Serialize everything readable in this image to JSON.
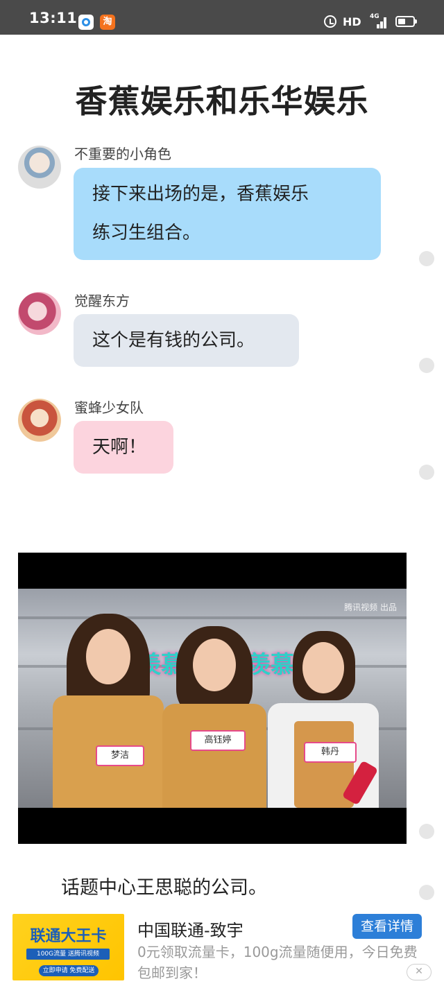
{
  "status_bar": {
    "time": "13:11",
    "app_icon_b_label": "淘",
    "network_label": "HD",
    "signal_label": "4G"
  },
  "article": {
    "title": "香蕉娱乐和乐华娱乐",
    "messages": [
      {
        "sender": "不重要的小角色",
        "text_lines": [
          "接下来出场的是，香蕉娱乐",
          "练习生组合。"
        ],
        "bubble_color": "#a8dcfb"
      },
      {
        "sender": "觉醒东方",
        "text_lines": [
          "这个是有钱的公司。"
        ],
        "bubble_color": "#e3e8ef"
      },
      {
        "sender": "蜜蜂少女队",
        "text_lines": [
          "天啊！"
        ],
        "bubble_color": "#fcd4de"
      }
    ],
    "video": {
      "wall_text": "羡慕",
      "watermark": "腾讯视频 出品",
      "name_tags": [
        "梦洁",
        "高钰婷",
        "韩丹"
      ]
    },
    "caption": "话题中心王思聪的公司。"
  },
  "ad": {
    "image_brand": "联通大王卡",
    "image_perk": "100G流量 送腾讯视频",
    "image_apply": "立即申请 免费配送",
    "title": "中国联通-致宇",
    "description": "0元领取流量卡，100g流量随便用，今日免费包邮到家！",
    "button_label": "查看详情",
    "close_symbol": "✕"
  },
  "icons": [
    "alarm-icon",
    "signal-icon",
    "battery-icon",
    "close-icon"
  ]
}
